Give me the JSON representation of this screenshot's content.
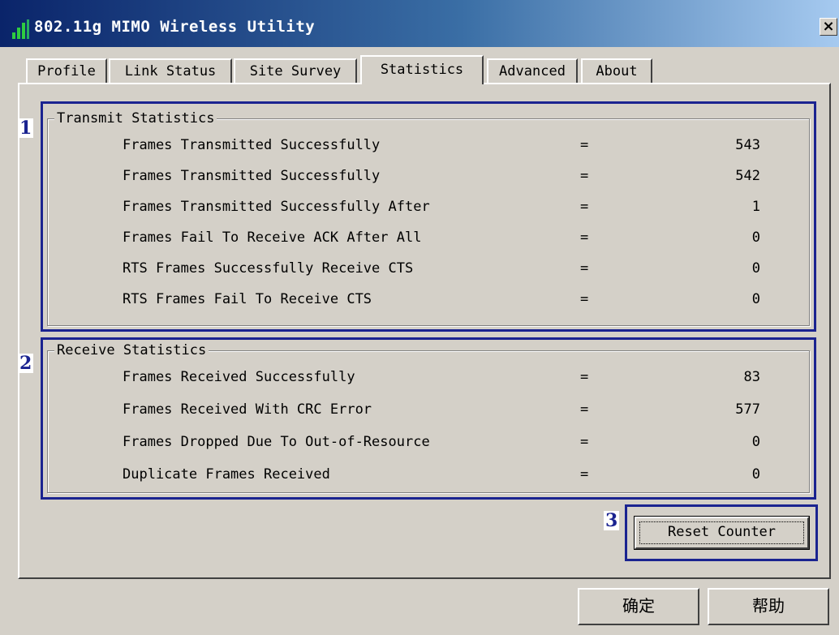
{
  "window": {
    "title": "802.11g MIMO Wireless Utility",
    "close_glyph": "×"
  },
  "tabs": [
    {
      "label": "Profile"
    },
    {
      "label": "Link Status"
    },
    {
      "label": "Site Survey"
    },
    {
      "label": "Statistics",
      "active": true
    },
    {
      "label": "Advanced"
    },
    {
      "label": "About"
    }
  ],
  "transmit": {
    "title": "Transmit Statistics",
    "marker": "1",
    "rows": [
      {
        "label": "Frames Transmitted Successfully",
        "eq": "=",
        "value": "543"
      },
      {
        "label": "Frames Transmitted Successfully",
        "eq": "=",
        "value": "542"
      },
      {
        "label": "Frames Transmitted Successfully After",
        "eq": "=",
        "value": "1"
      },
      {
        "label": "Frames Fail To Receive ACK After All",
        "eq": "=",
        "value": "0"
      },
      {
        "label": "RTS Frames Successfully Receive CTS",
        "eq": "=",
        "value": "0"
      },
      {
        "label": "RTS Frames Fail To Receive CTS",
        "eq": "=",
        "value": "0"
      }
    ]
  },
  "receive": {
    "title": "Receive Statistics",
    "marker": "2",
    "rows": [
      {
        "label": "Frames Received Successfully",
        "eq": "=",
        "value": "83"
      },
      {
        "label": "Frames Received With CRC Error",
        "eq": "=",
        "value": "577"
      },
      {
        "label": "Frames Dropped Due To Out-of-Resource",
        "eq": "=",
        "value": "0"
      },
      {
        "label": "Duplicate Frames Received",
        "eq": "=",
        "value": "0"
      }
    ]
  },
  "reset": {
    "marker": "3",
    "label": "Reset Counter"
  },
  "buttons": {
    "ok": "确定",
    "help": "帮助"
  },
  "colors": {
    "highlight": "#1a2390",
    "titlebar_start": "#0a246a",
    "titlebar_end": "#a6caf0",
    "face": "#d4d0c8"
  }
}
